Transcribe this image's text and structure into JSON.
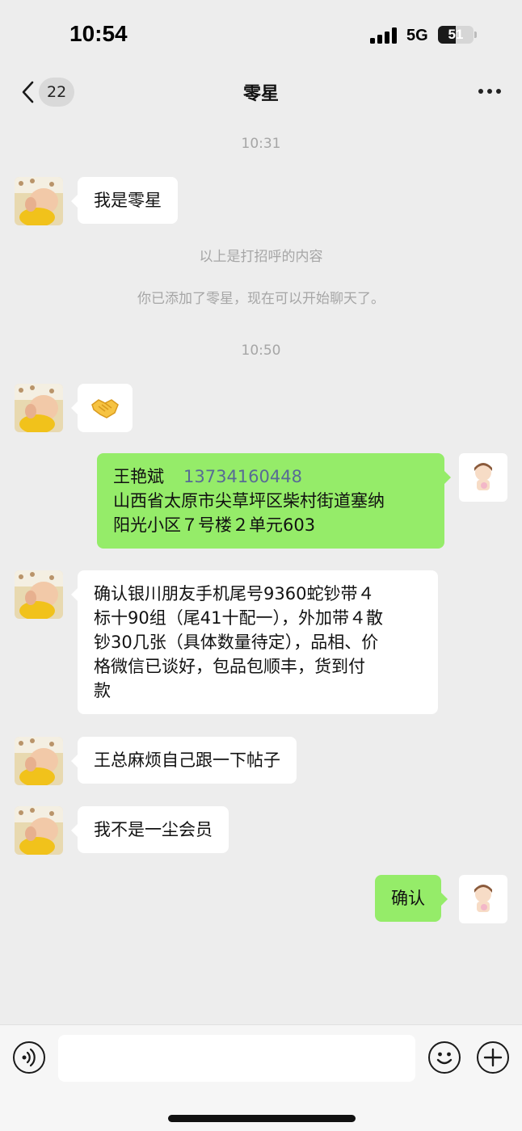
{
  "status_bar": {
    "time": "10:54",
    "network": "5G",
    "battery": "51",
    "battery_level": 0.51
  },
  "nav": {
    "unread_count": "22",
    "title": "零星",
    "back_icon": "chevron-left-icon",
    "more_icon": "more-dots-icon"
  },
  "messages": {
    "time_1": "10:31",
    "m1": "我是零星",
    "system_1": "以上是打招呼的内容",
    "system_2": "你已添加了零星，现在可以开始聊天了。",
    "time_2": "10:50",
    "m2_emoji": "handshake-icon",
    "m3": {
      "name": "王艳斌",
      "phone": "13734160448",
      "address_line1": "山西省太原市尖草坪区柴村街道塞纳",
      "address_line2": "阳光小区７号楼２单元603"
    },
    "m4": [
      "确认银川朋友手机尾号9360蛇钞带４",
      "标十90组（尾41十配一），外加带４散",
      "钞30几张（具体数量待定），品相、价",
      "格微信已谈好，包品包顺丰，货到付",
      "款"
    ],
    "m5": "王总麻烦自己跟一下帖子",
    "m6": "我不是一尘会员",
    "m7": "确认"
  },
  "input_bar": {
    "voice_icon": "voice-icon",
    "emoji_icon": "emoji-icon",
    "plus_icon": "plus-icon",
    "input_value": ""
  },
  "colors": {
    "background": "#ededed",
    "incoming_bubble": "#ffffff",
    "outgoing_bubble": "#95ec69",
    "link": "#576b95",
    "system_text": "#a6a6a6"
  }
}
